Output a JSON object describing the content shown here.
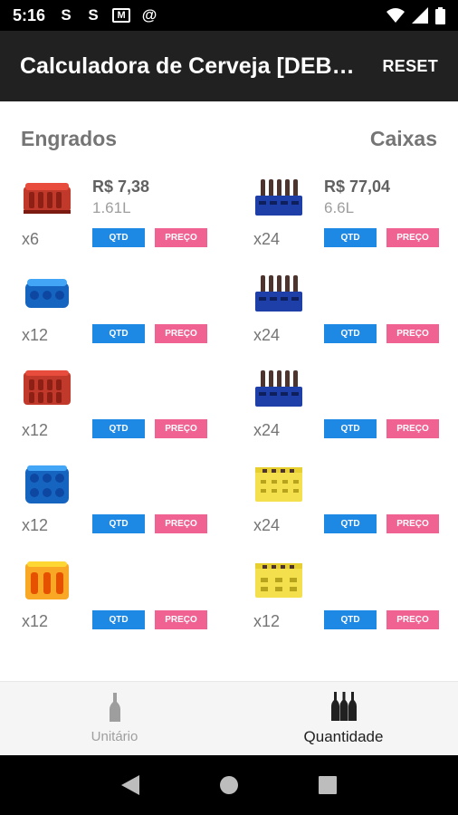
{
  "status_bar": {
    "time": "5:16",
    "icons": [
      "S",
      "S",
      "M",
      "@"
    ]
  },
  "app_bar": {
    "title": "Calculadora de Cerveja [DEB…",
    "reset_label": "RESET"
  },
  "headers": {
    "left": "Engrados",
    "right": "Caixas"
  },
  "left_items": [
    {
      "price": "R$ 7,38",
      "volume": "1.61L",
      "mult": "x6",
      "icon": "red-can-pack-icon"
    },
    {
      "price": "",
      "volume": "",
      "mult": "x12",
      "icon": "blue-can-pack-icon"
    },
    {
      "price": "",
      "volume": "",
      "mult": "x12",
      "icon": "red-can-pack-icon"
    },
    {
      "price": "",
      "volume": "",
      "mult": "x12",
      "icon": "blue-can-pack-icon"
    },
    {
      "price": "",
      "volume": "",
      "mult": "x12",
      "icon": "yellow-can-pack-icon"
    }
  ],
  "right_items": [
    {
      "price": "R$ 77,04",
      "volume": "6.6L",
      "mult": "x24",
      "icon": "blue-crate-icon"
    },
    {
      "price": "",
      "volume": "",
      "mult": "x24",
      "icon": "blue-crate-icon"
    },
    {
      "price": "",
      "volume": "",
      "mult": "x24",
      "icon": "blue-crate-icon"
    },
    {
      "price": "",
      "volume": "",
      "mult": "x24",
      "icon": "yellow-crate-icon"
    },
    {
      "price": "",
      "volume": "",
      "mult": "x12",
      "icon": "yellow-crate-icon"
    }
  ],
  "buttons": {
    "qtd": "QTD",
    "preco": "PREÇO"
  },
  "bottom_nav": {
    "tab1": "Unitário",
    "tab2": "Quantidade",
    "active": "Quantidade"
  },
  "colors": {
    "qtd": "#1e88e5",
    "preco": "#f06292",
    "app_bar": "#212121"
  }
}
